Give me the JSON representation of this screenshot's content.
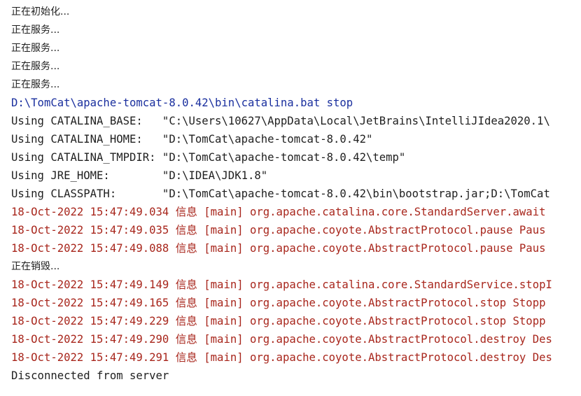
{
  "colors": {
    "background": "#ffffff",
    "normal_text": "#1f1f1f",
    "command_text": "#1a2f9e",
    "stderr_text": "#a8261c"
  },
  "console": {
    "lines": [
      {
        "kind": "plain",
        "text": "正在初始化..."
      },
      {
        "kind": "plain",
        "text": "正在服务..."
      },
      {
        "kind": "plain",
        "text": "正在服务..."
      },
      {
        "kind": "plain",
        "text": "正在服务..."
      },
      {
        "kind": "plain",
        "text": "正在服务..."
      },
      {
        "kind": "cmd",
        "text": "D:\\TomCat\\apache-tomcat-8.0.42\\bin\\catalina.bat stop"
      },
      {
        "kind": "plain",
        "text": "Using CATALINA_BASE:   \"C:\\Users\\10627\\AppData\\Local\\JetBrains\\IntelliJIdea2020.1\\"
      },
      {
        "kind": "plain",
        "text": "Using CATALINA_HOME:   \"D:\\TomCat\\apache-tomcat-8.0.42\""
      },
      {
        "kind": "plain",
        "text": "Using CATALINA_TMPDIR: \"D:\\TomCat\\apache-tomcat-8.0.42\\temp\""
      },
      {
        "kind": "plain",
        "text": "Using JRE_HOME:        \"D:\\IDEA\\JDK1.8\""
      },
      {
        "kind": "plain",
        "text": "Using CLASSPATH:       \"D:\\TomCat\\apache-tomcat-8.0.42\\bin\\bootstrap.jar;D:\\TomCat"
      },
      {
        "kind": "err",
        "text": "18-Oct-2022 15:47:49.034 信息 [main] org.apache.catalina.core.StandardServer.await"
      },
      {
        "kind": "err",
        "text": "18-Oct-2022 15:47:49.035 信息 [main] org.apache.coyote.AbstractProtocol.pause Paus"
      },
      {
        "kind": "err",
        "text": "18-Oct-2022 15:47:49.088 信息 [main] org.apache.coyote.AbstractProtocol.pause Paus"
      },
      {
        "kind": "plain",
        "text": "正在销毁..."
      },
      {
        "kind": "err",
        "text": "18-Oct-2022 15:47:49.149 信息 [main] org.apache.catalina.core.StandardService.stopI"
      },
      {
        "kind": "err",
        "text": "18-Oct-2022 15:47:49.165 信息 [main] org.apache.coyote.AbstractProtocol.stop Stopp"
      },
      {
        "kind": "err",
        "text": "18-Oct-2022 15:47:49.229 信息 [main] org.apache.coyote.AbstractProtocol.stop Stopp"
      },
      {
        "kind": "err",
        "text": "18-Oct-2022 15:47:49.290 信息 [main] org.apache.coyote.AbstractProtocol.destroy Des"
      },
      {
        "kind": "err",
        "text": "18-Oct-2022 15:47:49.291 信息 [main] org.apache.coyote.AbstractProtocol.destroy Des"
      },
      {
        "kind": "plain",
        "text": "Disconnected from server"
      }
    ]
  }
}
